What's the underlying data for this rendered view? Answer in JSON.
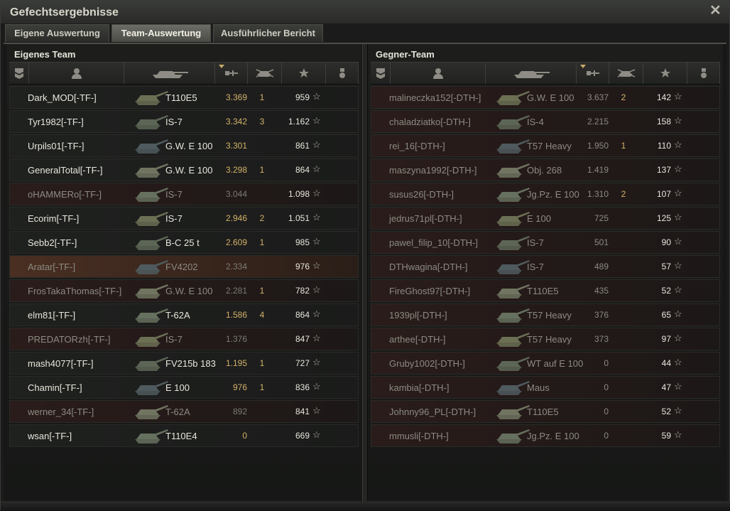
{
  "window": {
    "title": "Gefechtsergebnisse",
    "close_icon": "close-icon"
  },
  "tabs": [
    {
      "label": "Eigene Auswertung",
      "active": false
    },
    {
      "label": "Team-Auswertung",
      "active": true
    },
    {
      "label": "Ausführlicher Bericht",
      "active": false
    }
  ],
  "columns": [
    "rank-icon",
    "player-icon",
    "tank-icon",
    "damage-icon",
    "kills-icon",
    "xp-star-icon",
    "medal-icon"
  ],
  "teams": {
    "own": {
      "title": "Eigenes Team",
      "rows": [
        {
          "player": "Dark_MOD[-TF-]",
          "tank": "T110E5",
          "damage": "3.369",
          "kills": "1",
          "xp": "959",
          "state": "alive"
        },
        {
          "player": "Tyr1982[-TF-]",
          "tank": "IS-7",
          "damage": "3.342",
          "kills": "3",
          "xp": "1.162",
          "state": "alive"
        },
        {
          "player": "Urpils01[-TF-]",
          "tank": "G.W. E 100",
          "damage": "3.301",
          "kills": "",
          "xp": "861",
          "state": "alive"
        },
        {
          "player": "GeneralTotal[-TF-]",
          "tank": "G.W. E 100",
          "damage": "3.298",
          "kills": "1",
          "xp": "864",
          "state": "alive"
        },
        {
          "player": "oHAMMERo[-TF-]",
          "tank": "IS-7",
          "damage": "3.044",
          "kills": "",
          "xp": "1.098",
          "state": "dead"
        },
        {
          "player": "Ecorim[-TF-]",
          "tank": "IS-7",
          "damage": "2.946",
          "kills": "2",
          "xp": "1.051",
          "state": "alive"
        },
        {
          "player": "Sebb2[-TF-]",
          "tank": "B-C 25 t",
          "damage": "2.609",
          "kills": "1",
          "xp": "985",
          "state": "alive"
        },
        {
          "player": "Aratar[-TF-]",
          "tank": "FV4202",
          "damage": "2.334",
          "kills": "",
          "xp": "976",
          "state": "tk"
        },
        {
          "player": "FrosTakaThomas[-TF-]",
          "tank": "G.W. E 100",
          "damage": "2.281",
          "kills": "1",
          "xp": "782",
          "state": "dead"
        },
        {
          "player": "elm81[-TF-]",
          "tank": "T-62A",
          "damage": "1.586",
          "kills": "4",
          "xp": "864",
          "state": "alive"
        },
        {
          "player": "PREDATORzh[-TF-]",
          "tank": "IS-7",
          "damage": "1.376",
          "kills": "",
          "xp": "847",
          "state": "dead"
        },
        {
          "player": "mash4077[-TF-]",
          "tank": "FV215b 183",
          "damage": "1.195",
          "kills": "1",
          "xp": "727",
          "state": "alive"
        },
        {
          "player": "Chamin[-TF-]",
          "tank": "E 100",
          "damage": "976",
          "kills": "1",
          "xp": "836",
          "state": "alive"
        },
        {
          "player": "werner_34[-TF-]",
          "tank": "T-62A",
          "damage": "892",
          "kills": "",
          "xp": "841",
          "state": "dead"
        },
        {
          "player": "wsan[-TF-]",
          "tank": "T110E4",
          "damage": "0",
          "kills": "",
          "xp": "669",
          "state": "alive"
        }
      ]
    },
    "enemy": {
      "title": "Gegner-Team",
      "rows": [
        {
          "player": "malineczka152[-DTH-]",
          "tank": "G.W. E 100",
          "damage": "3.637",
          "kills": "2",
          "xp": "142",
          "state": "dead"
        },
        {
          "player": "chaladziatko[-DTH-]",
          "tank": "IS-4",
          "damage": "2.215",
          "kills": "",
          "xp": "158",
          "state": "dead"
        },
        {
          "player": "rei_16[-DTH-]",
          "tank": "T57 Heavy",
          "damage": "1.950",
          "kills": "1",
          "xp": "110",
          "state": "dead"
        },
        {
          "player": "maszyna1992[-DTH-]",
          "tank": "Obj. 268",
          "damage": "1.419",
          "kills": "",
          "xp": "137",
          "state": "dead"
        },
        {
          "player": "susus26[-DTH-]",
          "tank": "Jg.Pz. E 100",
          "damage": "1.310",
          "kills": "2",
          "xp": "107",
          "state": "dead"
        },
        {
          "player": "jedrus71pl[-DTH-]",
          "tank": "E 100",
          "damage": "725",
          "kills": "",
          "xp": "125",
          "state": "dead"
        },
        {
          "player": "pawel_filip_10[-DTH-]",
          "tank": "IS-7",
          "damage": "501",
          "kills": "",
          "xp": "90",
          "state": "dead"
        },
        {
          "player": "DTHwagina[-DTH-]",
          "tank": "IS-7",
          "damage": "489",
          "kills": "",
          "xp": "57",
          "state": "dead"
        },
        {
          "player": "FireGhost97[-DTH-]",
          "tank": "T110E5",
          "damage": "435",
          "kills": "",
          "xp": "52",
          "state": "dead"
        },
        {
          "player": "1939pl[-DTH-]",
          "tank": "T57 Heavy",
          "damage": "376",
          "kills": "",
          "xp": "65",
          "state": "dead"
        },
        {
          "player": "arthee[-DTH-]",
          "tank": "T57 Heavy",
          "damage": "373",
          "kills": "",
          "xp": "97",
          "state": "dead"
        },
        {
          "player": "Gruby1002[-DTH-]",
          "tank": "WT auf E 100",
          "damage": "0",
          "kills": "",
          "xp": "44",
          "state": "dead"
        },
        {
          "player": "kambia[-DTH-]",
          "tank": "Maus",
          "damage": "0",
          "kills": "",
          "xp": "47",
          "state": "dead"
        },
        {
          "player": "Johnny96_PL[-DTH-]",
          "tank": "T110E5",
          "damage": "0",
          "kills": "",
          "xp": "52",
          "state": "dead"
        },
        {
          "player": "mmusli[-DTH-]",
          "tank": "Jg.Pz. E 100",
          "damage": "0",
          "kills": "",
          "xp": "59",
          "state": "dead"
        }
      ]
    }
  },
  "colors": {
    "accent": "#d4b16a",
    "dead_row": "#2a1c1a",
    "tk_row": "#4a2f22"
  }
}
